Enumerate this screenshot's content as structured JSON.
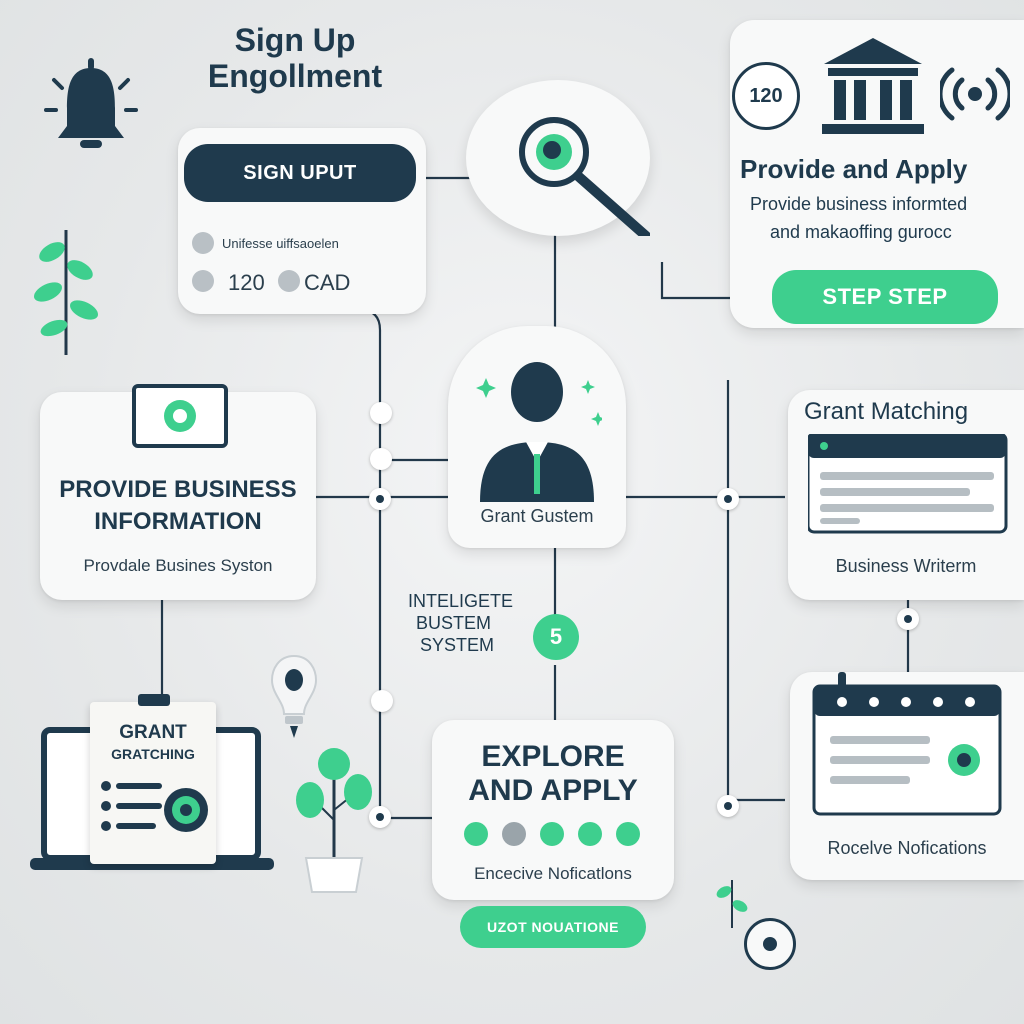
{
  "title": {
    "line1": "Sign Up",
    "line2": "Engollment"
  },
  "signup_card": {
    "button": "SIGN UPUT",
    "row1": "Unifesse uiffsaoelen",
    "row2_amount": "120",
    "row2_currency": "CAD"
  },
  "provide_apply_card": {
    "badge": "120",
    "heading": "Provide and Apply",
    "sub1": "Provide business informted",
    "sub2": "and makaoffing gurocc",
    "button": "STEP  STEP"
  },
  "business_info_card": {
    "heading1": "PROVIDE BUSINESS",
    "heading2": "INFORMATION",
    "sub": "Provdale Busines Syston"
  },
  "grant_system_card": {
    "label": "Grant Gustem"
  },
  "grant_matching_card": {
    "heading": "Grant Matching",
    "sub": "Business Writerm"
  },
  "intelligent_system": {
    "line1": "INTELIGETE",
    "line2": "BUSTEM",
    "line3": "SYSTEM",
    "badge": "5"
  },
  "laptop_card": {
    "line1": "GRANT",
    "line2": "GRATCHING"
  },
  "explore_card": {
    "heading1": "EXPLORE",
    "heading2": "AND APPLY",
    "sub": "Encecive Noficatlons",
    "button": "UZOT NOUATIONE"
  },
  "notifications_card": {
    "label": "Rocelve Nofications"
  },
  "colors": {
    "navy": "#1f3a4d",
    "green": "#3ecf8e",
    "card": "#f8f9f9",
    "background": "#e9ebec"
  },
  "icons": [
    "bell-icon",
    "search-magnifier-icon",
    "bank-icon",
    "signal-icon",
    "plant-icon",
    "user-tie-icon",
    "lightbulb-icon",
    "potted-plant-icon",
    "calendar-icon",
    "browser-window-icon",
    "laptop-icon",
    "gear-icon"
  ]
}
